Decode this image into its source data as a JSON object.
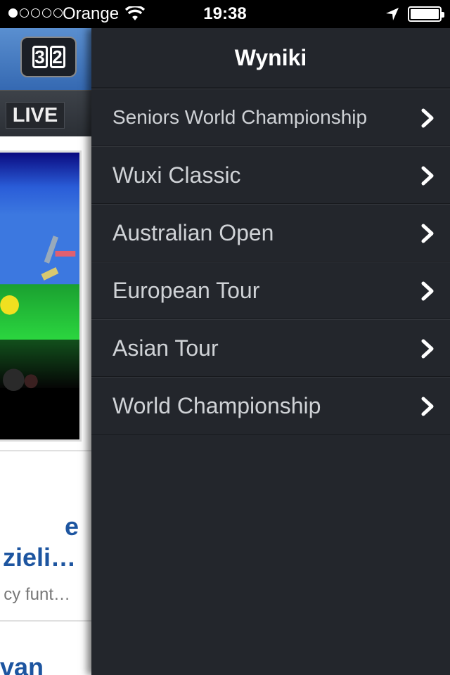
{
  "status_bar": {
    "carrier": "Orange",
    "time": "19:38"
  },
  "peek": {
    "live_label": "LIVE",
    "logo_digits": [
      "3",
      "2"
    ],
    "headline_1": "e",
    "headline_2": "zieli…",
    "subtitle": "cy funt…",
    "headline_3": "van"
  },
  "drawer": {
    "title": "Wyniki",
    "items": [
      {
        "label": "Seniors World Championship"
      },
      {
        "label": "Wuxi Classic"
      },
      {
        "label": "Australian Open"
      },
      {
        "label": "European Tour"
      },
      {
        "label": "Asian Tour"
      },
      {
        "label": "World Championship"
      }
    ]
  },
  "colors": {
    "drawer_bg": "#23262c",
    "status_bar_bg": "#000000",
    "header_blue": "#3569b2",
    "headline_blue": "#1d55a0"
  }
}
